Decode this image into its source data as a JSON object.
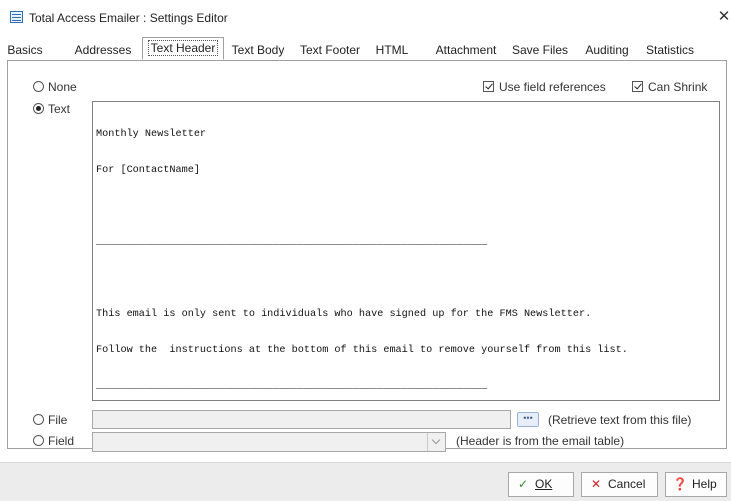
{
  "window": {
    "title": "Total Access Emailer : Settings Editor",
    "close_glyph": "✕"
  },
  "tabs": [
    {
      "label": "Basics"
    },
    {
      "label": "Addresses"
    },
    {
      "label": "Text Header",
      "active": true
    },
    {
      "label": "Text Body"
    },
    {
      "label": "Text Footer"
    },
    {
      "label": "HTML"
    },
    {
      "label": "Attachment"
    },
    {
      "label": "Save Files"
    },
    {
      "label": "Auditing"
    },
    {
      "label": "Statistics"
    }
  ],
  "options": {
    "none_label": "None",
    "text_label": "Text",
    "file_label": "File",
    "field_label": "Field",
    "selected": "Text",
    "use_field_references_label": "Use field references",
    "use_field_references_checked": true,
    "can_shrink_label": "Can Shrink",
    "can_shrink_checked": true
  },
  "text_content": {
    "lines": [
      "Monthly Newsletter",
      "For [ContactName]",
      "",
      "________________________________________________________________",
      "",
      "This email is only sent to individuals who have signed up for the FMS Newsletter.",
      "Follow the  instructions at the bottom of this email to remove yourself from this list.",
      "________________________________________________________________"
    ]
  },
  "file": {
    "value": "",
    "browse_glyph": "•••",
    "hint": "(Retrieve text from this file)"
  },
  "field": {
    "value": "",
    "hint": "(Header is from the email table)"
  },
  "buttons": {
    "ok": {
      "label": "OK",
      "icon": "check-icon",
      "color": "#2e8b2e"
    },
    "cancel": {
      "label": "Cancel",
      "icon": "x-icon",
      "color": "#d42020"
    },
    "help": {
      "label": "Help",
      "icon": "help-icon",
      "color": "#1f5fbf"
    }
  }
}
